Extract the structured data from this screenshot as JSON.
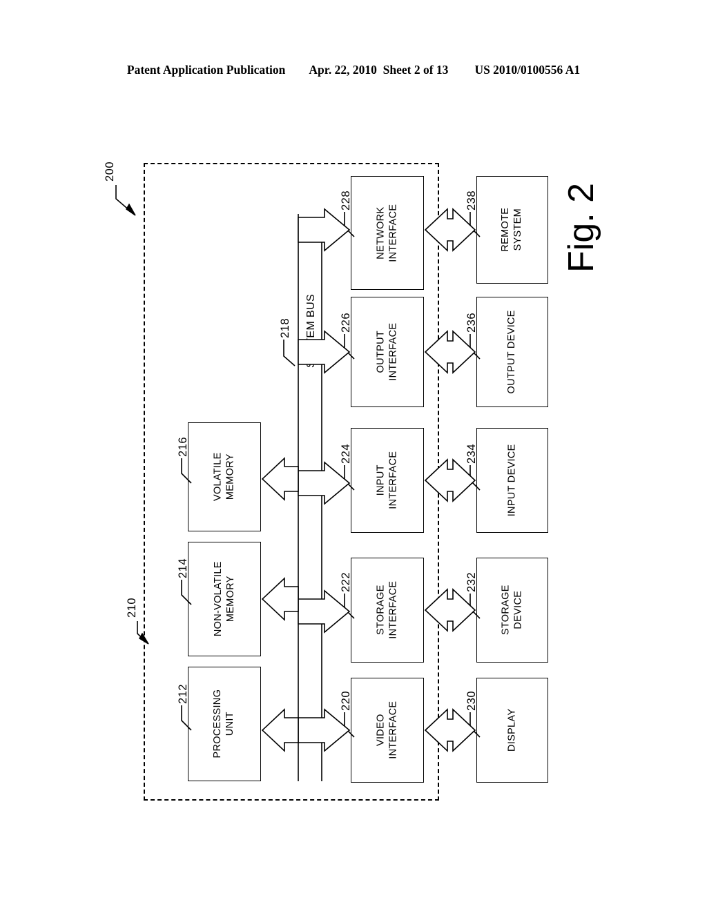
{
  "header": {
    "publication": "Patent Application Publication",
    "date": "Apr. 22, 2010",
    "sheet": "Sheet 2 of 13",
    "patent_number": "US 2010/0100556 A1"
  },
  "figure": {
    "label": "Fig. 2",
    "system_ref": "200",
    "enclosure_ref": "210",
    "bus_label": "SYSTEM BUS",
    "bus_ref": "218"
  },
  "core_blocks": [
    {
      "label_line1": "PROCESSING",
      "label_line2": "UNIT",
      "ref": "212"
    },
    {
      "label_line1": "NON-VOLATILE",
      "label_line2": "MEMORY",
      "ref": "214"
    },
    {
      "label_line1": "VOLATILE",
      "label_line2": "MEMORY",
      "ref": "216"
    }
  ],
  "interface_blocks": [
    {
      "label_line1": "VIDEO",
      "label_line2": "INTERFACE",
      "ref": "220"
    },
    {
      "label_line1": "STORAGE",
      "label_line2": "INTERFACE",
      "ref": "222"
    },
    {
      "label_line1": "INPUT",
      "label_line2": "INTERFACE",
      "ref": "224"
    },
    {
      "label_line1": "OUTPUT",
      "label_line2": "INTERFACE",
      "ref": "226"
    },
    {
      "label_line1": "NETWORK",
      "label_line2": "INTERFACE",
      "ref": "228"
    }
  ],
  "peripheral_blocks": [
    {
      "label_line1": "DISPLAY",
      "label_line2": "",
      "ref": "230"
    },
    {
      "label_line1": "STORAGE",
      "label_line2": "DEVICE",
      "ref": "232"
    },
    {
      "label_line1": "INPUT DEVICE",
      "label_line2": "",
      "ref": "234"
    },
    {
      "label_line1": "OUTPUT DEVICE",
      "label_line2": "",
      "ref": "236"
    },
    {
      "label_line1": "REMOTE",
      "label_line2": "SYSTEM",
      "ref": "238"
    }
  ]
}
